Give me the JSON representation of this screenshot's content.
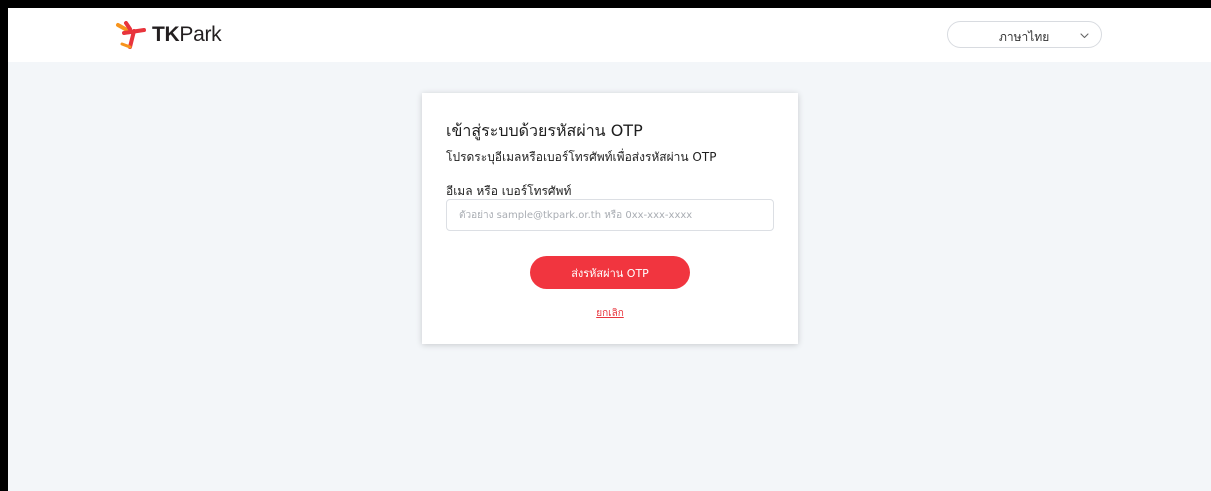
{
  "header": {
    "logo": {
      "mark": "tkpark-logo-mark",
      "text_bold": "TK",
      "text_regular": "Park"
    },
    "language_select": {
      "value": "ภาษาไทย",
      "icon": "chevron-down-icon"
    }
  },
  "login_card": {
    "title": "เข้าสู่ระบบด้วยรหัสผ่าน OTP",
    "subtitle": "โปรดระบุอีเมลหรือเบอร์โทรศัพท์เพื่อส่งรหัสผ่าน OTP",
    "field_label": "อีเมล หรือ เบอร์โทรศัพท์",
    "input_value": "",
    "input_placeholder": "ตัวอย่าง sample@tkpark.or.th หรือ 0xx-xxx-xxxx",
    "send_button": "ส่งรหัสผ่าน OTP",
    "cancel_link": "ยกเลิก"
  },
  "colors": {
    "accent": "#f1353f",
    "background": "#f3f6f9",
    "logo_orange": "#f7941d",
    "logo_red": "#e8343c"
  }
}
